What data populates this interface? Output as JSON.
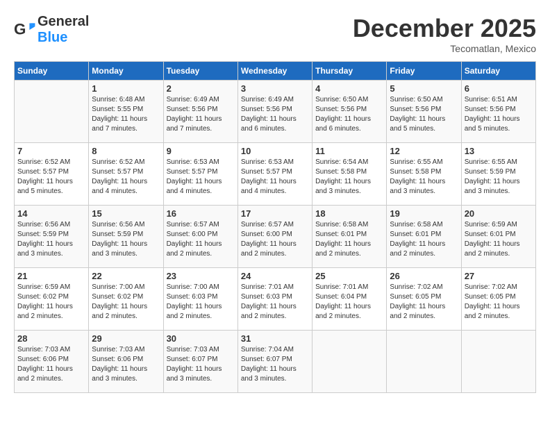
{
  "header": {
    "logo": {
      "general": "General",
      "blue": "Blue"
    },
    "month": "December 2025",
    "location": "Tecomatlan, Mexico"
  },
  "days_of_week": [
    "Sunday",
    "Monday",
    "Tuesday",
    "Wednesday",
    "Thursday",
    "Friday",
    "Saturday"
  ],
  "weeks": [
    [
      {
        "day": "",
        "info": ""
      },
      {
        "day": "1",
        "info": "Sunrise: 6:48 AM\nSunset: 5:55 PM\nDaylight: 11 hours\nand 7 minutes."
      },
      {
        "day": "2",
        "info": "Sunrise: 6:49 AM\nSunset: 5:56 PM\nDaylight: 11 hours\nand 7 minutes."
      },
      {
        "day": "3",
        "info": "Sunrise: 6:49 AM\nSunset: 5:56 PM\nDaylight: 11 hours\nand 6 minutes."
      },
      {
        "day": "4",
        "info": "Sunrise: 6:50 AM\nSunset: 5:56 PM\nDaylight: 11 hours\nand 6 minutes."
      },
      {
        "day": "5",
        "info": "Sunrise: 6:50 AM\nSunset: 5:56 PM\nDaylight: 11 hours\nand 5 minutes."
      },
      {
        "day": "6",
        "info": "Sunrise: 6:51 AM\nSunset: 5:56 PM\nDaylight: 11 hours\nand 5 minutes."
      }
    ],
    [
      {
        "day": "7",
        "info": "Sunrise: 6:52 AM\nSunset: 5:57 PM\nDaylight: 11 hours\nand 5 minutes."
      },
      {
        "day": "8",
        "info": "Sunrise: 6:52 AM\nSunset: 5:57 PM\nDaylight: 11 hours\nand 4 minutes."
      },
      {
        "day": "9",
        "info": "Sunrise: 6:53 AM\nSunset: 5:57 PM\nDaylight: 11 hours\nand 4 minutes."
      },
      {
        "day": "10",
        "info": "Sunrise: 6:53 AM\nSunset: 5:57 PM\nDaylight: 11 hours\nand 4 minutes."
      },
      {
        "day": "11",
        "info": "Sunrise: 6:54 AM\nSunset: 5:58 PM\nDaylight: 11 hours\nand 3 minutes."
      },
      {
        "day": "12",
        "info": "Sunrise: 6:55 AM\nSunset: 5:58 PM\nDaylight: 11 hours\nand 3 minutes."
      },
      {
        "day": "13",
        "info": "Sunrise: 6:55 AM\nSunset: 5:59 PM\nDaylight: 11 hours\nand 3 minutes."
      }
    ],
    [
      {
        "day": "14",
        "info": "Sunrise: 6:56 AM\nSunset: 5:59 PM\nDaylight: 11 hours\nand 3 minutes."
      },
      {
        "day": "15",
        "info": "Sunrise: 6:56 AM\nSunset: 5:59 PM\nDaylight: 11 hours\nand 3 minutes."
      },
      {
        "day": "16",
        "info": "Sunrise: 6:57 AM\nSunset: 6:00 PM\nDaylight: 11 hours\nand 2 minutes."
      },
      {
        "day": "17",
        "info": "Sunrise: 6:57 AM\nSunset: 6:00 PM\nDaylight: 11 hours\nand 2 minutes."
      },
      {
        "day": "18",
        "info": "Sunrise: 6:58 AM\nSunset: 6:01 PM\nDaylight: 11 hours\nand 2 minutes."
      },
      {
        "day": "19",
        "info": "Sunrise: 6:58 AM\nSunset: 6:01 PM\nDaylight: 11 hours\nand 2 minutes."
      },
      {
        "day": "20",
        "info": "Sunrise: 6:59 AM\nSunset: 6:01 PM\nDaylight: 11 hours\nand 2 minutes."
      }
    ],
    [
      {
        "day": "21",
        "info": "Sunrise: 6:59 AM\nSunset: 6:02 PM\nDaylight: 11 hours\nand 2 minutes."
      },
      {
        "day": "22",
        "info": "Sunrise: 7:00 AM\nSunset: 6:02 PM\nDaylight: 11 hours\nand 2 minutes."
      },
      {
        "day": "23",
        "info": "Sunrise: 7:00 AM\nSunset: 6:03 PM\nDaylight: 11 hours\nand 2 minutes."
      },
      {
        "day": "24",
        "info": "Sunrise: 7:01 AM\nSunset: 6:03 PM\nDaylight: 11 hours\nand 2 minutes."
      },
      {
        "day": "25",
        "info": "Sunrise: 7:01 AM\nSunset: 6:04 PM\nDaylight: 11 hours\nand 2 minutes."
      },
      {
        "day": "26",
        "info": "Sunrise: 7:02 AM\nSunset: 6:05 PM\nDaylight: 11 hours\nand 2 minutes."
      },
      {
        "day": "27",
        "info": "Sunrise: 7:02 AM\nSunset: 6:05 PM\nDaylight: 11 hours\nand 2 minutes."
      }
    ],
    [
      {
        "day": "28",
        "info": "Sunrise: 7:03 AM\nSunset: 6:06 PM\nDaylight: 11 hours\nand 2 minutes."
      },
      {
        "day": "29",
        "info": "Sunrise: 7:03 AM\nSunset: 6:06 PM\nDaylight: 11 hours\nand 3 minutes."
      },
      {
        "day": "30",
        "info": "Sunrise: 7:03 AM\nSunset: 6:07 PM\nDaylight: 11 hours\nand 3 minutes."
      },
      {
        "day": "31",
        "info": "Sunrise: 7:04 AM\nSunset: 6:07 PM\nDaylight: 11 hours\nand 3 minutes."
      },
      {
        "day": "",
        "info": ""
      },
      {
        "day": "",
        "info": ""
      },
      {
        "day": "",
        "info": ""
      }
    ]
  ]
}
